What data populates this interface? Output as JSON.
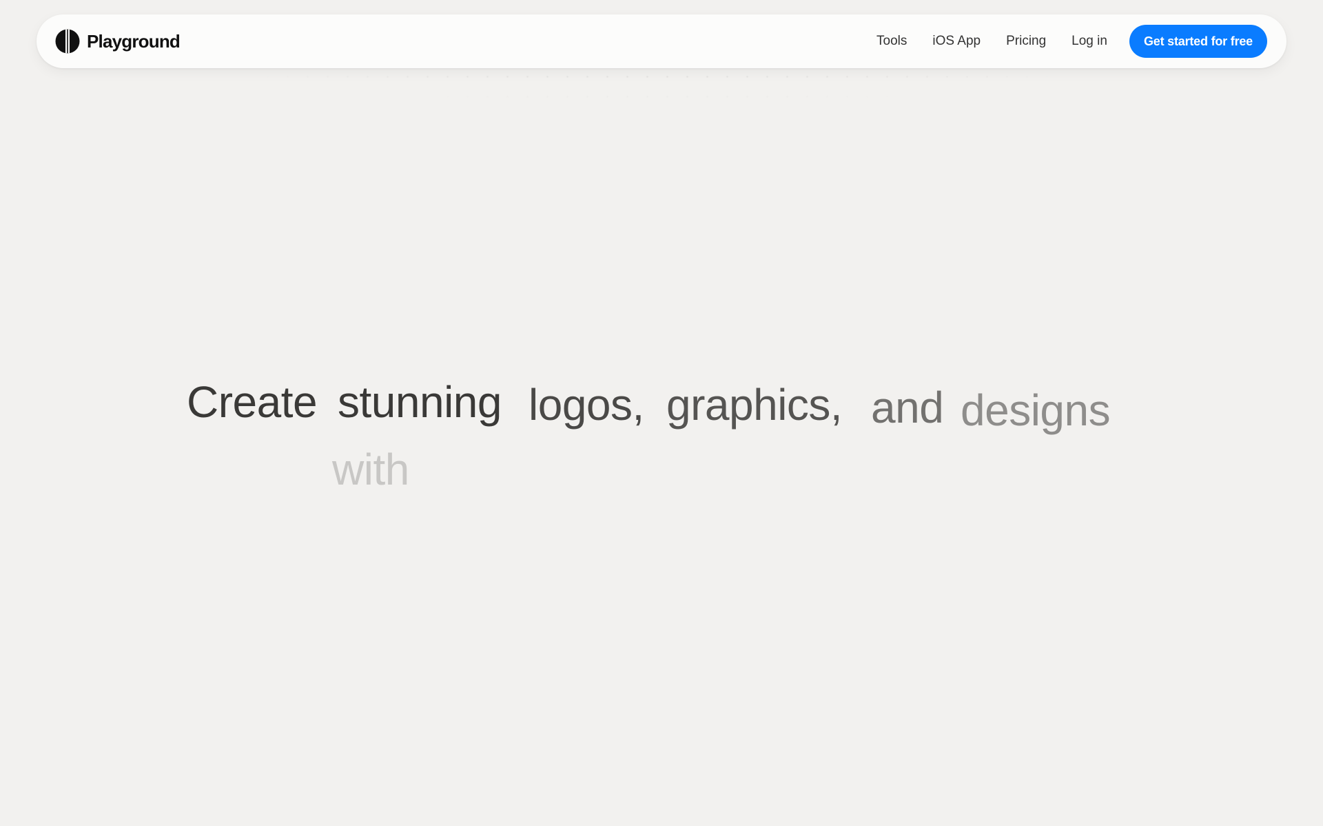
{
  "navbar": {
    "brand_name": "Playground",
    "logo_icon": "playground-logo-icon",
    "links": [
      {
        "label": "Tools"
      },
      {
        "label": "iOS App"
      },
      {
        "label": "Pricing"
      },
      {
        "label": "Log in"
      }
    ],
    "cta_label": "Get started for free"
  },
  "hero": {
    "words": [
      "Create",
      "stunning",
      "logos,",
      "graphics,",
      "and",
      "designs",
      "with"
    ]
  },
  "colors": {
    "background": "#f2f1ef",
    "navbar_bg": "#fcfcfb",
    "accent": "#0a7cff",
    "text_dark": "#3a3937"
  }
}
